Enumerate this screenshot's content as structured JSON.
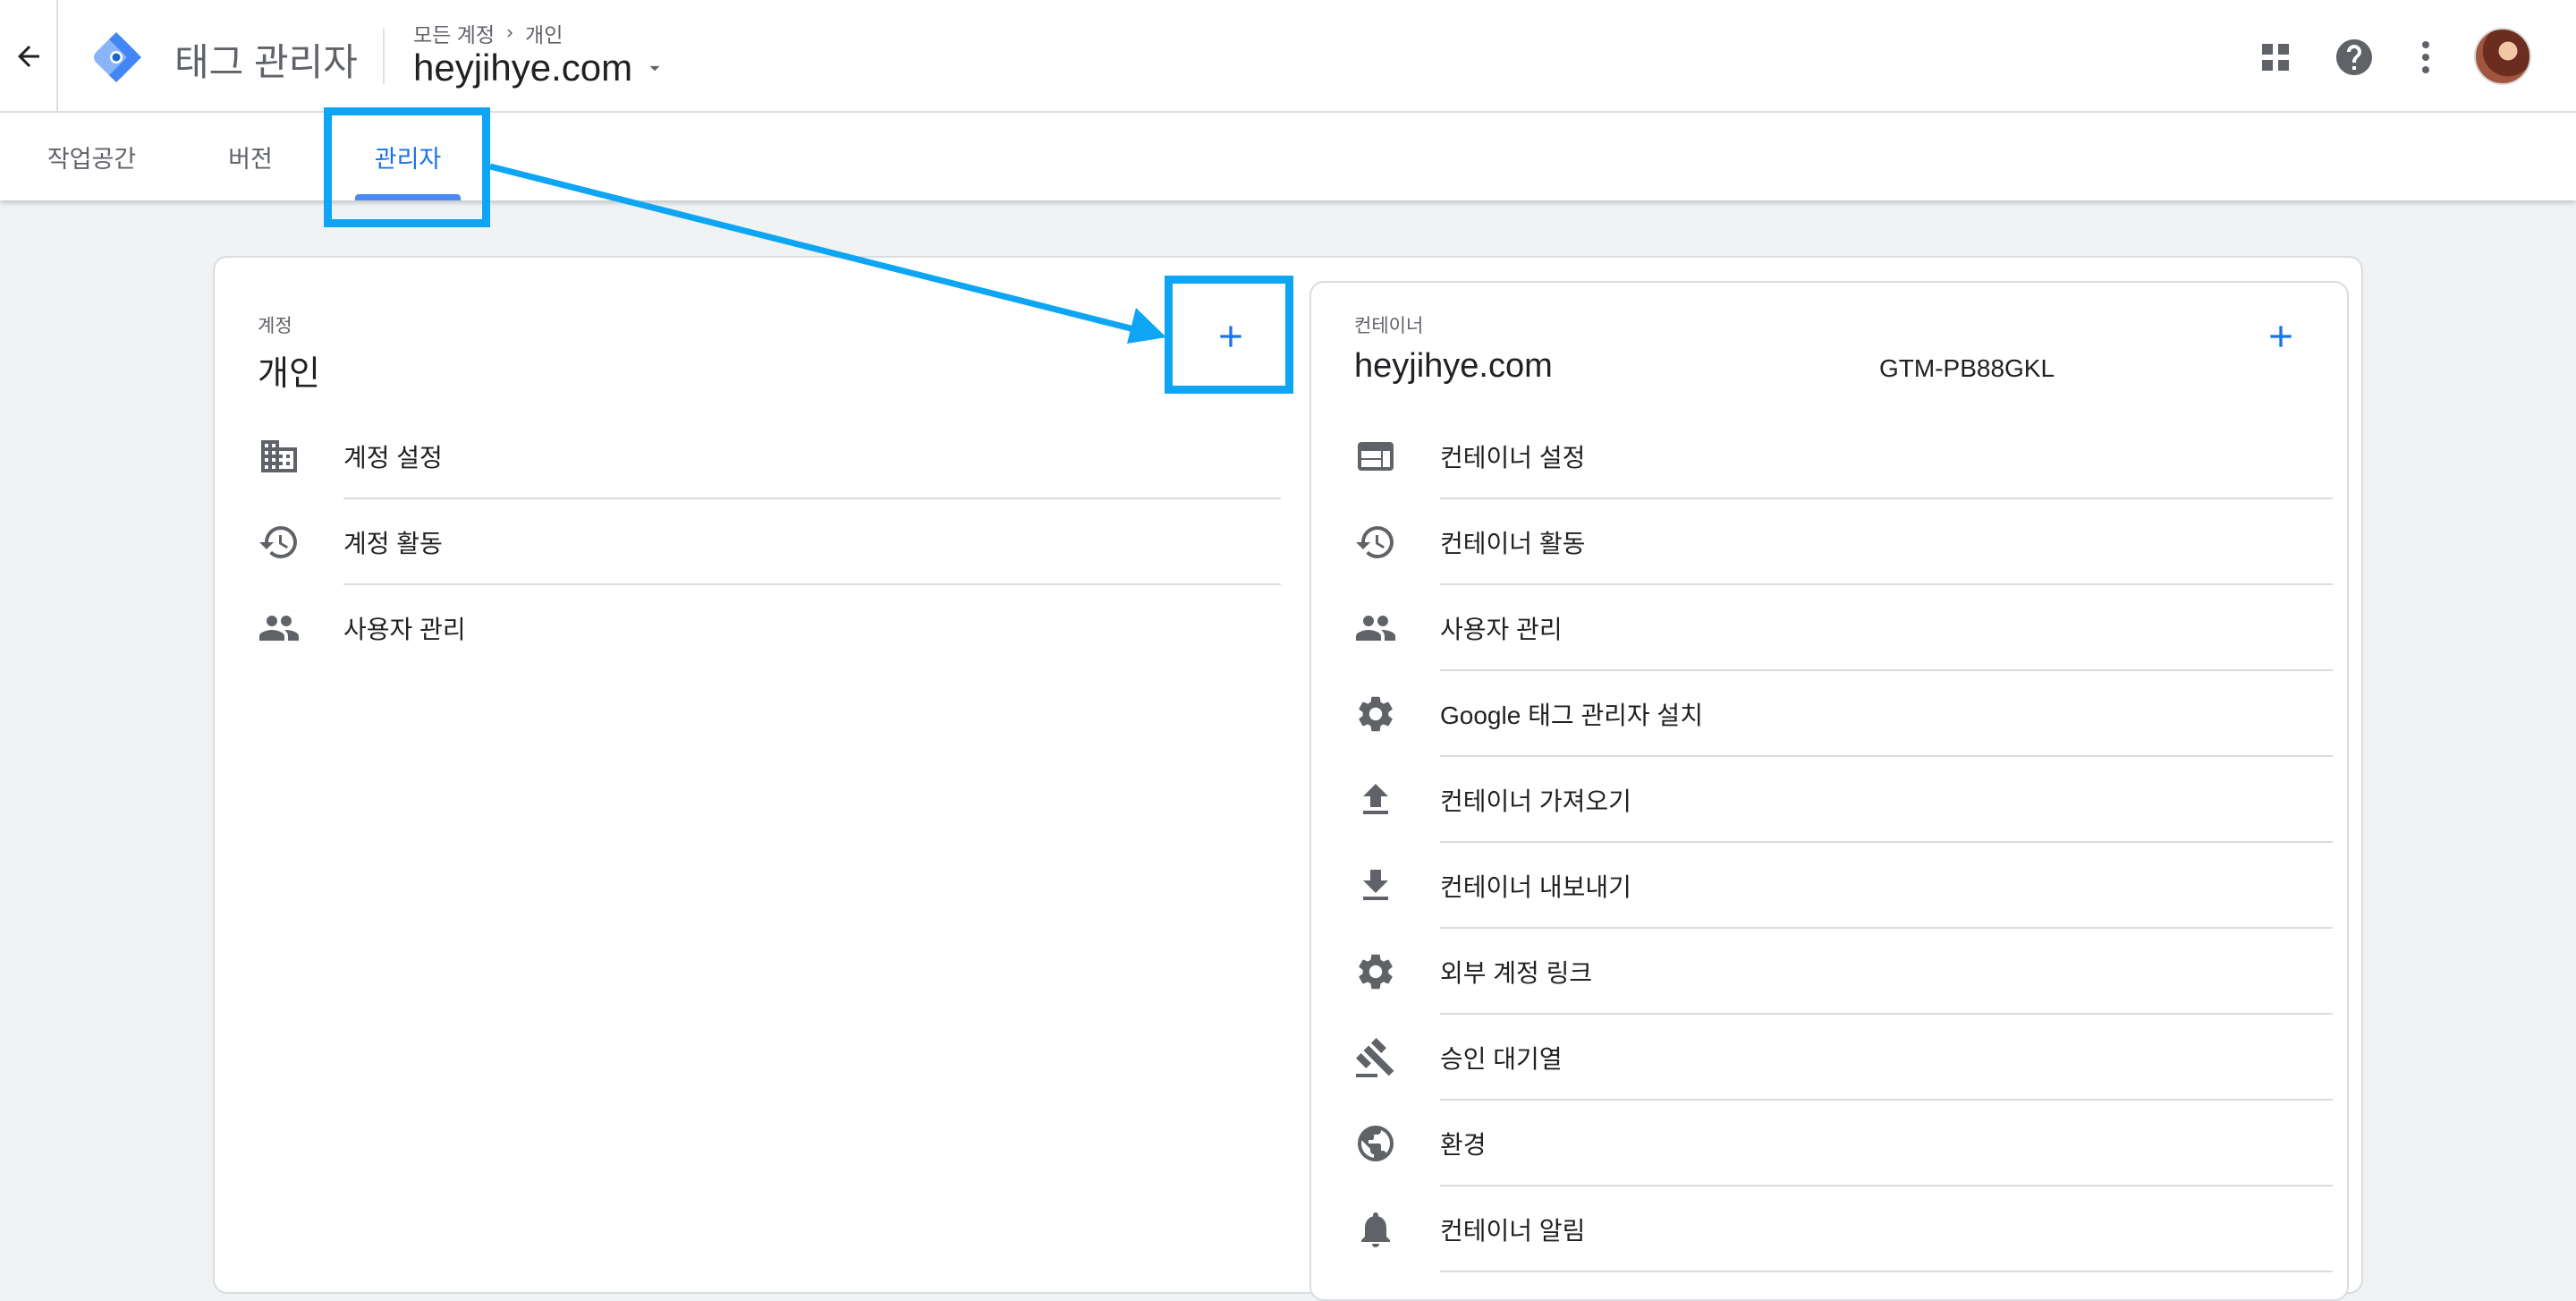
{
  "header": {
    "app_title": "태그 관리자",
    "breadcrumb": [
      "모든 계정",
      "개인"
    ],
    "container_name": "heyjihye.com",
    "icons": [
      "back-arrow-icon",
      "gtm-logo-icon",
      "apps-grid-icon",
      "help-icon",
      "more-vert-icon",
      "avatar"
    ]
  },
  "tabs": [
    {
      "label": "작업공간",
      "active": false
    },
    {
      "label": "버전",
      "active": false
    },
    {
      "label": "관리자",
      "active": true
    }
  ],
  "account": {
    "section_label": "계정",
    "name": "개인",
    "items": [
      {
        "label": "계정 설정",
        "icon": "building-icon"
      },
      {
        "label": "계정 활동",
        "icon": "history-icon"
      },
      {
        "label": "사용자 관리",
        "icon": "people-icon"
      }
    ]
  },
  "container": {
    "section_label": "컨테이너",
    "name": "heyjihye.com",
    "id": "GTM-PB88GKL",
    "items": [
      {
        "label": "컨테이너 설정",
        "icon": "web-icon"
      },
      {
        "label": "컨테이너 활동",
        "icon": "history-icon"
      },
      {
        "label": "사용자 관리",
        "icon": "people-icon"
      },
      {
        "label": "Google 태그 관리자 설치",
        "icon": "gear-icon"
      },
      {
        "label": "컨테이너 가져오기",
        "icon": "upload-icon"
      },
      {
        "label": "컨테이너 내보내기",
        "icon": "download-icon"
      },
      {
        "label": "외부 계정 링크",
        "icon": "gear-icon"
      },
      {
        "label": "승인 대기열",
        "icon": "gavel-icon"
      },
      {
        "label": "환경",
        "icon": "globe-icon"
      },
      {
        "label": "컨테이너 알림",
        "icon": "bell-icon"
      }
    ]
  },
  "colors": {
    "accent": "#1a73e8",
    "highlight": "#0ea5f4",
    "icon_grey": "#5f6368",
    "background": "#eff3f4"
  }
}
